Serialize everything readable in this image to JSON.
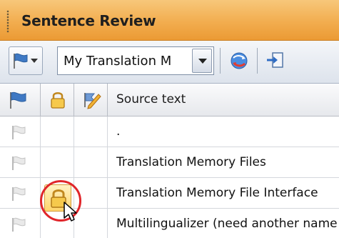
{
  "panel": {
    "title": "Sentence Review"
  },
  "toolbar": {
    "flag_button_icon": "flag-dropdown-icon",
    "memory_select_value": "My Translation M",
    "refresh_icon": "refresh-globe-icon",
    "export_icon": "export-icon"
  },
  "grid": {
    "columns": [
      {
        "icon": "flag-icon"
      },
      {
        "icon": "lock-icon"
      },
      {
        "icon": "edit-flag-icon"
      },
      {
        "label": "Source text"
      }
    ],
    "rows": [
      {
        "flag": "flag-icon",
        "locked": false,
        "source": "."
      },
      {
        "flag": "flag-icon",
        "locked": false,
        "source": "Translation Memory Files"
      },
      {
        "flag": "flag-icon",
        "locked": true,
        "source": "Translation Memory File Interface"
      },
      {
        "flag": "flag-icon",
        "locked": false,
        "source": "Multilingualizer (need another name"
      }
    ]
  },
  "colors": {
    "title_bar": "#f2ad4f",
    "highlight_ring": "#e0252a",
    "lock_highlight": "#ffd56b"
  }
}
